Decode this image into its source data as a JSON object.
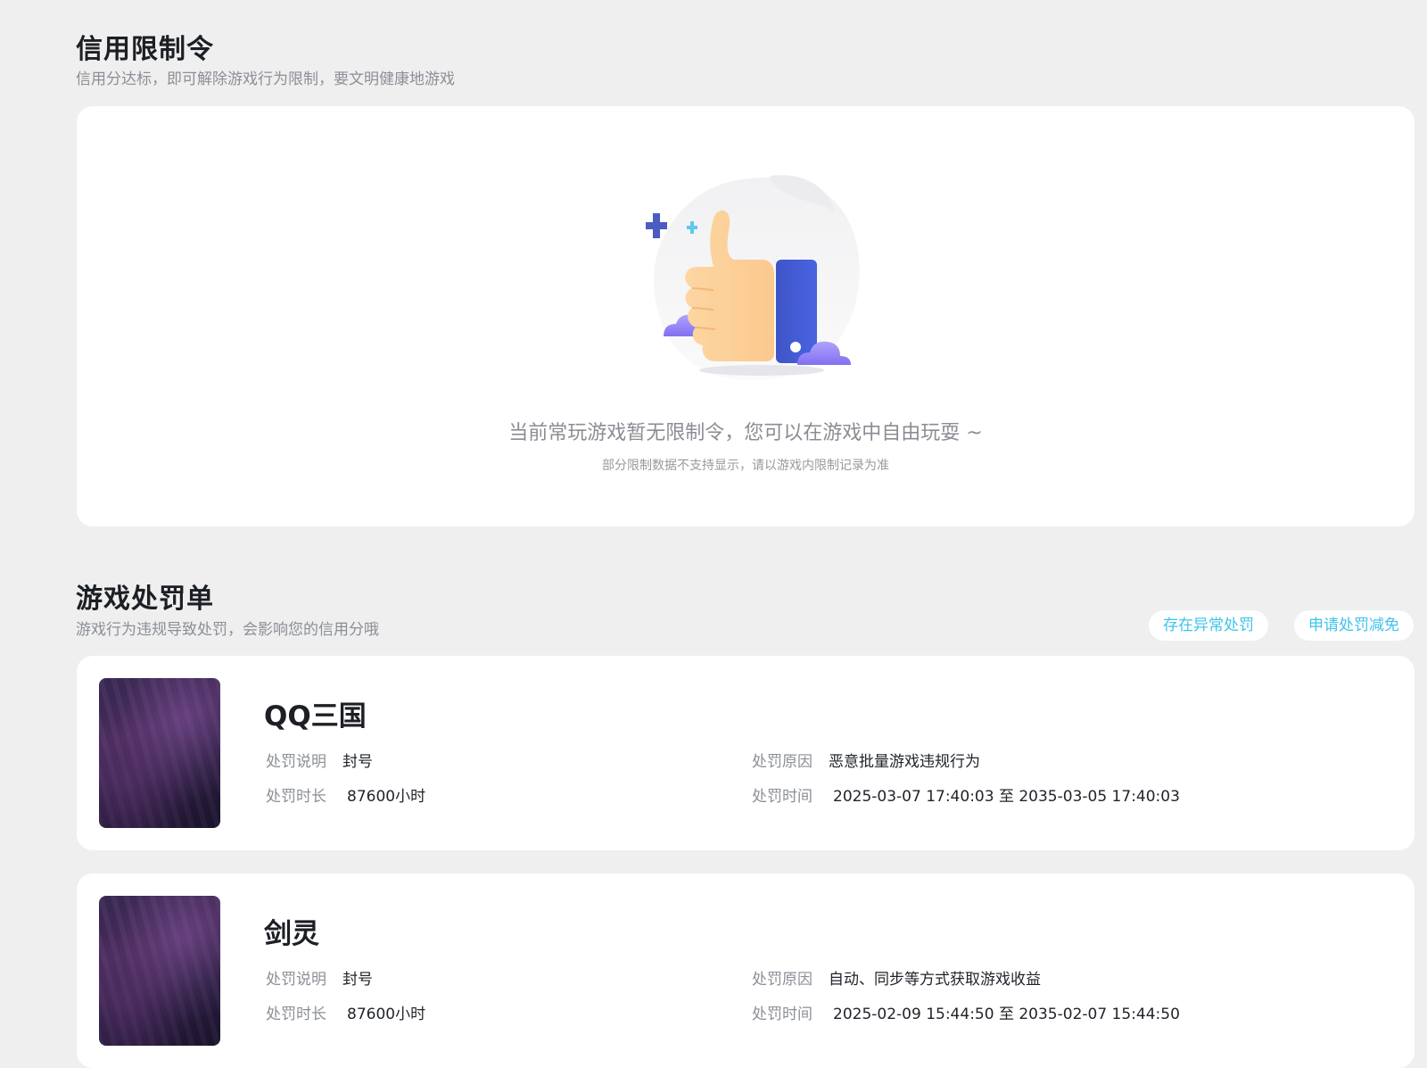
{
  "credit_section": {
    "title": "信用限制令",
    "subtitle": "信用分达标，即可解除游戏行为限制，要文明健康地游戏",
    "empty_title": "当前常玩游戏暂无限制令，您可以在游戏中自由玩耍 ~",
    "empty_note": "部分限制数据不支持显示，请以游戏内限制记录为准"
  },
  "penalty_section": {
    "title": "游戏处罚单",
    "subtitle": "游戏行为违规导致处罚，会影响您的信用分哦",
    "buttons": {
      "abnormal": "存在异常处罚",
      "appeal": "申请处罚减免"
    },
    "labels": {
      "desc": "处罚说明",
      "reason": "处罚原因",
      "duration": "处罚时长",
      "time": "处罚时间"
    },
    "items": [
      {
        "game": "QQ三国",
        "desc": "封号",
        "reason": "恶意批量游戏违规行为",
        "duration": "87600小时",
        "time": "2025-03-07 17:40:03 至 2035-03-05 17:40:03"
      },
      {
        "game": "剑灵",
        "desc": "封号",
        "reason": "自动、同步等方式获取游戏收益",
        "duration": "87600小时",
        "time": "2025-02-09 15:44:50 至 2035-02-07 15:44:50"
      }
    ]
  },
  "colors": {
    "accent": "#3ec3ec",
    "background": "#efefef",
    "card": "#ffffff",
    "muted_text": "#8b8f96"
  },
  "icons": {
    "illustration": "thumbs-up-illustration",
    "cover": "game-cover-image"
  }
}
